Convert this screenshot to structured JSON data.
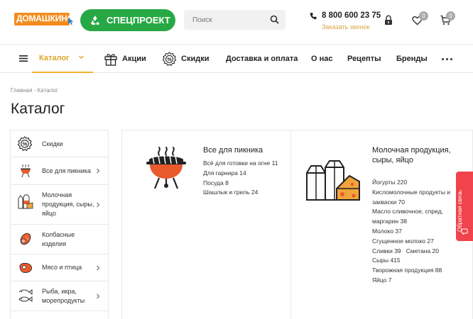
{
  "header": {
    "logo_text": "ДОМАШКИНО",
    "special_button": "СПЕЦПРОЕКТ",
    "search_placeholder": "Поиск",
    "phone": "8 800 600 23 75",
    "callback": "Заказать звонок",
    "favorites_count": "0",
    "cart_count": "0"
  },
  "nav": {
    "catalog": "Каталог",
    "items": [
      "Акции",
      "Скидки",
      "Доставка и оплата",
      "О нас",
      "Рецепты",
      "Бренды"
    ]
  },
  "breadcrumb": {
    "home": "Главная",
    "separator": "-",
    "current": "Каталог"
  },
  "page_title": "Каталог",
  "sidebar": {
    "items": [
      {
        "label": "Скидки",
        "icon": "percent-badge-icon"
      },
      {
        "label": "Все для пикника",
        "icon": "grill-icon"
      },
      {
        "label": "Молочная продукция, сыры, яйцо",
        "icon": "milk-icon"
      },
      {
        "label": "Колбасные изделия",
        "icon": "sausage-icon"
      },
      {
        "label": "Мясо и птица",
        "icon": "meat-icon"
      },
      {
        "label": "Рыба, икра, морепродукты",
        "icon": "fish-icon"
      }
    ]
  },
  "cards": [
    {
      "title": "Все для пикника",
      "icon": "grill-icon",
      "links": [
        "Всё для готовки на огне 11",
        "Для гарнира 14",
        "Посуда 8",
        "Шашлык и гриль 24"
      ]
    },
    {
      "title": "Молочная продукция, сыры, яйцо",
      "icon": "dairy-icon",
      "links": [
        "Йогурты 220",
        "Кисломолочные продукты и закваски 70",
        "Масло сливочное, спред, маргарин 38",
        "Молоко 37",
        "Сгущенное молоко 27",
        "Сливки 39",
        "Сметана 20",
        "Сыры 415",
        "Творожная продукция 88",
        "Яйцо 7"
      ]
    }
  ],
  "feedback": "Обратная связь",
  "colors": {
    "accent": "#f0b32d",
    "green": "#27a844",
    "orange": "#f28c1e",
    "feedback": "#f0434b",
    "grill": "#e95a2c"
  }
}
